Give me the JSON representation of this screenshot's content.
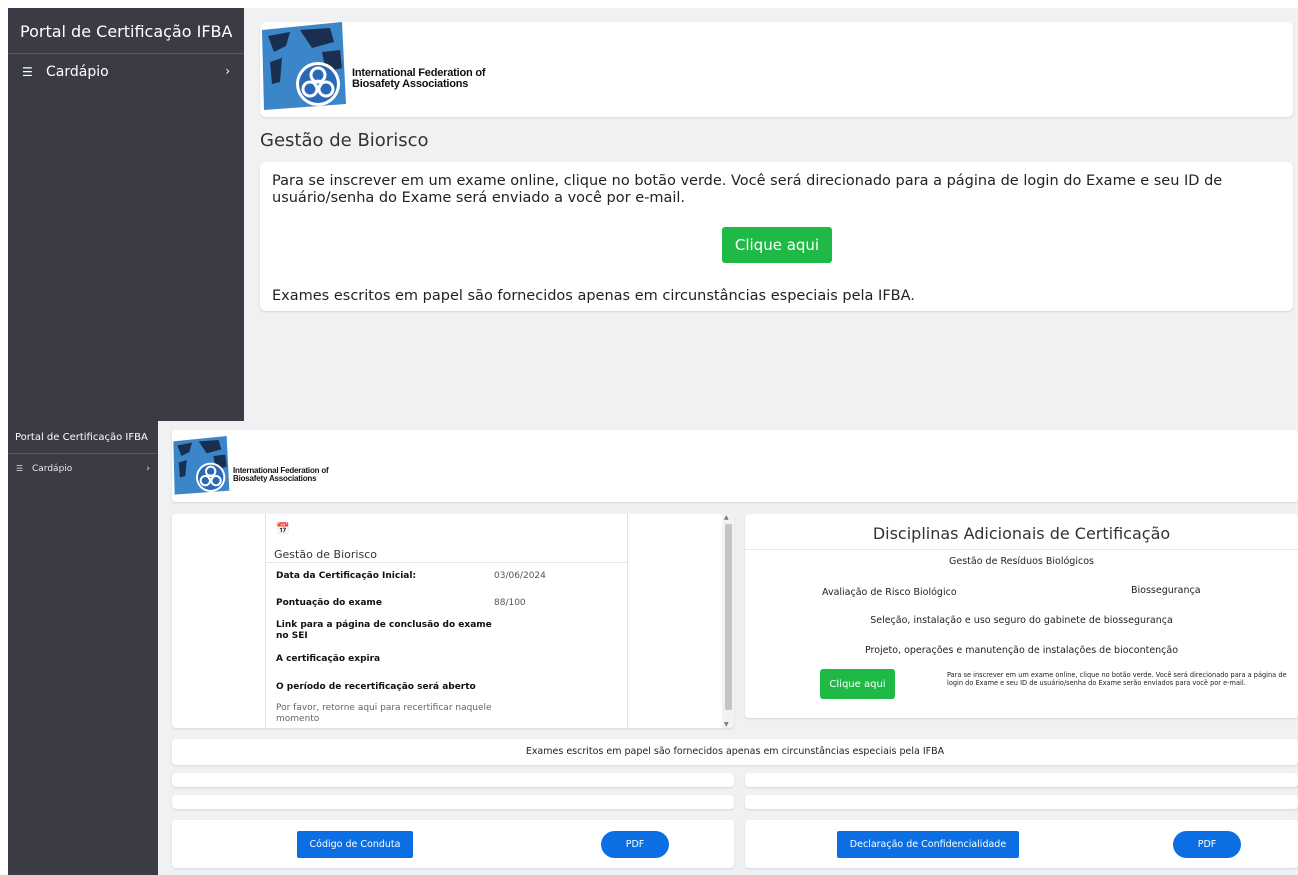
{
  "screen1": {
    "sidebar": {
      "title": "Portal de Certificação IFBA",
      "menu_label": "Cardápio",
      "chevron": "›"
    },
    "logo": {
      "line1": "International Federation of",
      "line2": "Biosafety Associations"
    },
    "page_title": "Gestão de Biorisco",
    "info": {
      "text": "Para se inscrever em um exame online, clique no botão verde. Você será direcionado para a página de login do Exame e seu ID de usuário/senha do Exame será enviado a você por e-mail.",
      "button": "Clique aqui",
      "footer": "Exames escritos em papel são fornecidos apenas em circunstâncias especiais pela IFBA."
    }
  },
  "screen2": {
    "sidebar": {
      "title": "Portal de Certificação IFBA",
      "menu_label": "Cardápio",
      "chevron": "›"
    },
    "logo": {
      "line1": "International Federation of",
      "line2": "Biosafety Associations"
    },
    "certification": {
      "title": "Gestão de Biorisco",
      "rows": [
        {
          "label": "Data da Certificação Inicial:",
          "value": "03/06/2024"
        },
        {
          "label": "Pontuação do exame",
          "value": "88/100"
        },
        {
          "label": "Link para a página de conclusão do exame no SEI",
          "value": ""
        },
        {
          "label": "A certificação expira",
          "value": ""
        },
        {
          "label": "O período de recertificação será aberto",
          "value": ""
        }
      ],
      "note": "Por favor, retorne aqui para recertificar naquele momento"
    },
    "additional": {
      "title": "Disciplinas Adicionais de Certificação",
      "disciplines": [
        "Gestão de Resíduos Biológicos",
        "Avaliação de Risco Biológico",
        "Biossegurança",
        "Seleção, instalação e uso seguro do gabinete de biossegurança",
        "Projeto, operações e manutenção de instalações de biocontenção"
      ],
      "button": "Clique aqui",
      "text": "Para se inscrever em um exame online, clique no botão verde. Você será direcionado para a página de login do Exame e seu ID de usuário/senha do Exame serão enviados para você por e-mail."
    },
    "paper_notice": "Exames escritos em papel são fornecidos apenas em circunstâncias especiais pela IFBA",
    "documents": [
      {
        "label": "Código de Conduta",
        "pdf": "PDF"
      },
      {
        "label": "Declaração de Confidencialidade",
        "pdf": "PDF"
      }
    ]
  },
  "colors": {
    "sidebar": "#3a3b44",
    "background": "#f0f1f3",
    "green_button": "#1fba45",
    "blue_button": "#0b6fe3"
  }
}
